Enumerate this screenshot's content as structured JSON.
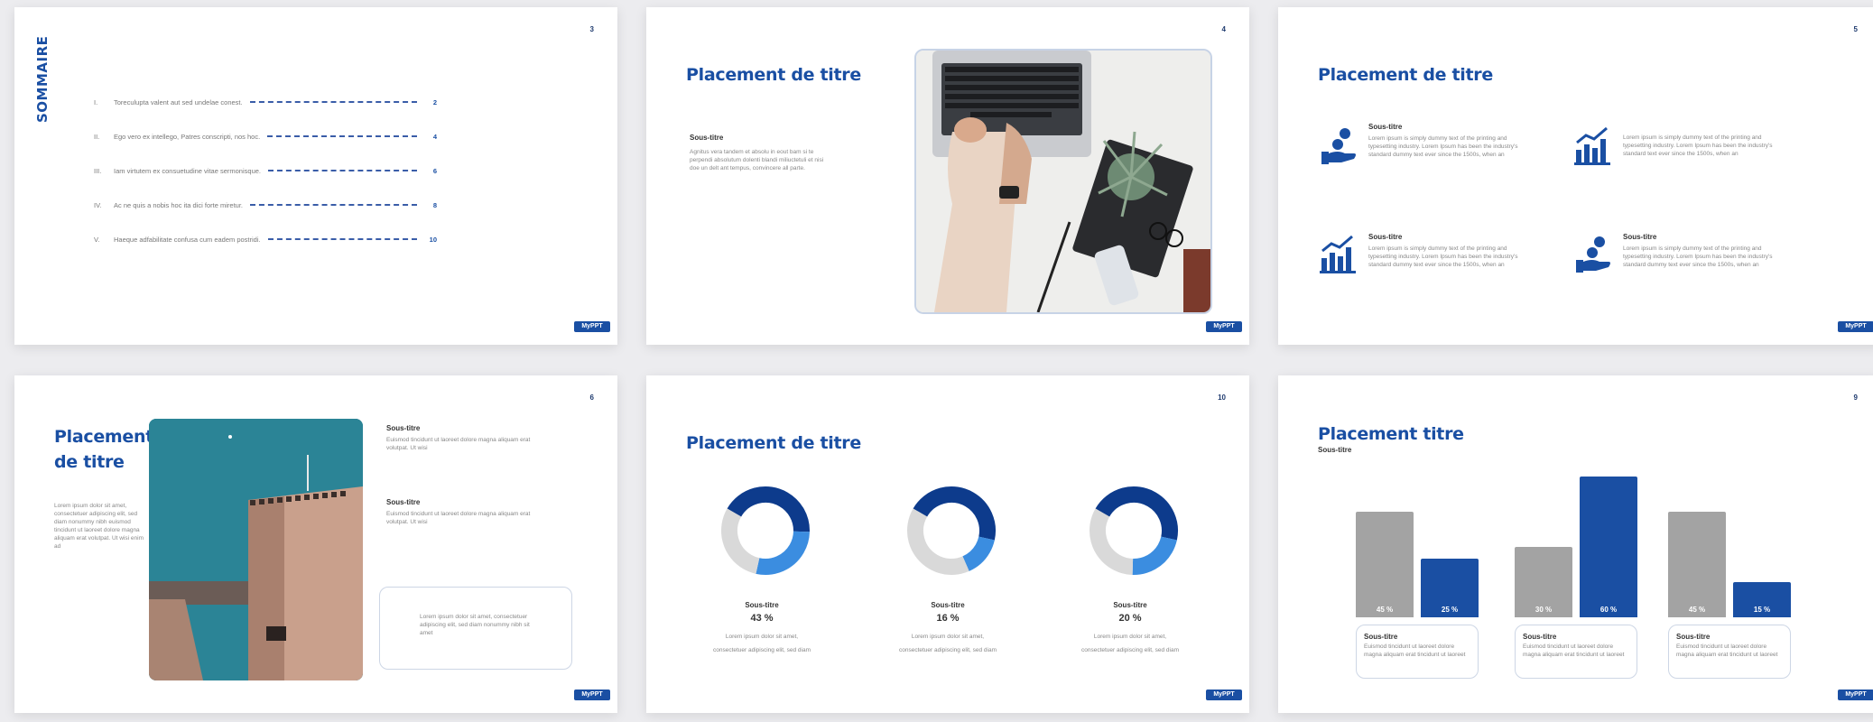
{
  "brand_label": "MyPPT",
  "slides": {
    "s1": {
      "page": "3",
      "title": "SOMMAIRE",
      "toc": [
        {
          "num": "I.",
          "text": "Toreculupta valent aut sed undelae conest.",
          "page": "2"
        },
        {
          "num": "II.",
          "text": "Ego vero ex intellego, Patres conscripti, nos hoc.",
          "page": "4"
        },
        {
          "num": "III.",
          "text": "Iam virtutem ex consuetudine vitae sermonisque.",
          "page": "6"
        },
        {
          "num": "IV.",
          "text": "Ac ne quis a nobis hoc ita dici forte miretur.",
          "page": "8"
        },
        {
          "num": "V.",
          "text": "Haeque adfabilitate confusa cum eadem postridi.",
          "page": "10"
        }
      ]
    },
    "s2": {
      "page": "4",
      "title": "Placement de titre",
      "subtitle": "Sous-titre",
      "body": "Agnitus vera tandem et absolu in eout bam si te perpendi absolutum dolenti blandi miliuctetuli et nisi doe un delt ant tempus, convincere all parte."
    },
    "s3": {
      "page": "5",
      "title": "Placement de titre",
      "items": [
        {
          "icon": "money-hand-icon",
          "title": "Sous-titre",
          "text": "Lorem ipsum is simply dummy text of the printing and typesetting industry. Lorem Ipsum has been the industry's standard dummy text ever since the 1500s, when an"
        },
        {
          "icon": "bar-chart-icon",
          "title": "",
          "text": "Lorem ipsum is simply dummy text of the printing and typesetting industry. Lorem Ipsum has been the industry's standard text ever since the 1500s, when an"
        },
        {
          "icon": "bar-chart-icon",
          "title": "Sous-titre",
          "text": "Lorem ipsum is simply dummy text of the printing and typesetting industry. Lorem Ipsum has been the industry's standard dummy text ever since the 1500s, when an"
        },
        {
          "icon": "money-hand-icon",
          "title": "Sous-titre",
          "text": "Lorem ipsum is simply dummy text of the printing and typesetting industry. Lorem Ipsum has been the industry's standard dummy text ever since the 1500s, when an"
        }
      ]
    },
    "s4": {
      "page": "6",
      "title": "Placement de titre",
      "body": "Lorem ipsum dolor sit amet, consectetuer adipiscing elit, sed diam nonummy nibh euismod tincidunt ut laoreet dolore magna aliquam erat volutpat. Ut wisi enim ad",
      "blocks": [
        {
          "title": "Sous-titre",
          "text": "Euismod tincidunt ut laoreet dolore magna aliquam erat volutpat. Ut wisi"
        },
        {
          "title": "Sous-titre",
          "text": "Euismod tincidunt ut laoreet dolore magna aliquam erat volutpat. Ut wisi"
        }
      ],
      "card_text": "Lorem ipsum dolor sit amet, consectetuer adipiscing elit, sed diam nonummy nibh sit amet"
    },
    "s5": {
      "page": "10",
      "title": "Placement de titre",
      "donuts": [
        {
          "subtitle": "Sous-titre",
          "value_label": "43 %",
          "text1": "Lorem ipsum dolor sit amet,",
          "text2": "consectetuer adipiscing elit, sed diam"
        },
        {
          "subtitle": "Sous-titre",
          "value_label": "16 %",
          "text1": "Lorem ipsum dolor sit amet,",
          "text2": "consectetuer adipiscing elit, sed diam"
        },
        {
          "subtitle": "Sous-titre",
          "value_label": "20 %",
          "text1": "Lorem ipsum dolor sit amet,",
          "text2": "consectetuer adipiscing elit, sed diam"
        }
      ]
    },
    "s6": {
      "page": "9",
      "title": "Placement titre",
      "subtitle": "Sous-titre",
      "groups": [
        {
          "gray": 45,
          "blue": 25,
          "gray_label": "45 %",
          "blue_label": "25 %",
          "title": "Sous-titre",
          "text": "Euismod tincidunt ut laoreet dolore magna aliquam erat tincidunt ut laoreet"
        },
        {
          "gray": 30,
          "blue": 60,
          "gray_label": "30 %",
          "blue_label": "60 %",
          "title": "Sous-titre",
          "text": "Euismod tincidunt ut laoreet dolore magna aliquam erat tincidunt ut laoreet"
        },
        {
          "gray": 45,
          "blue": 15,
          "gray_label": "45 %",
          "blue_label": "15 %",
          "title": "Sous-titre",
          "text": "Euismod tincidunt ut laoreet dolore magna aliquam erat tincidunt ut laoreet"
        }
      ]
    }
  },
  "colors": {
    "brand_blue": "#1a4fa3",
    "dark_blue": "#0d3b8c",
    "light_blue": "#3b8de0",
    "gray": "#a3a3a3",
    "light_gray": "#d9d9d9"
  }
}
